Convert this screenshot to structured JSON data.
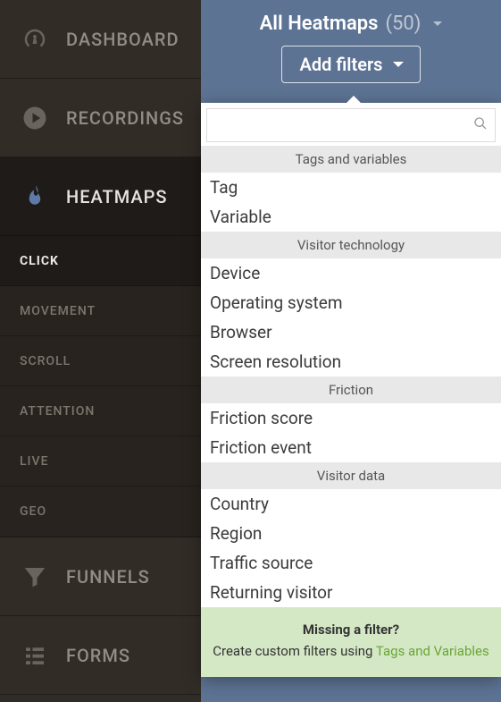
{
  "sidebar": {
    "items": [
      {
        "label": "DASHBOARD",
        "icon": "gauge",
        "active": false
      },
      {
        "label": "RECORDINGS",
        "icon": "play",
        "active": false
      },
      {
        "label": "HEATMAPS",
        "icon": "flame",
        "active": true
      },
      {
        "label": "FUNNELS",
        "icon": "funnel",
        "active": false
      },
      {
        "label": "FORMS",
        "icon": "list",
        "active": false
      }
    ],
    "heatmap_sub": [
      {
        "label": "CLICK",
        "active": true
      },
      {
        "label": "MOVEMENT",
        "active": false
      },
      {
        "label": "SCROLL",
        "active": false
      },
      {
        "label": "ATTENTION",
        "active": false
      },
      {
        "label": "LIVE",
        "active": false
      },
      {
        "label": "GEO",
        "active": false
      }
    ]
  },
  "panel": {
    "title": "All Heatmaps",
    "count_label": "(50)",
    "add_filters_label": "Add filters"
  },
  "filter_dropdown": {
    "search_placeholder": "",
    "sections": [
      {
        "header": "Tags and variables",
        "items": [
          "Tag",
          "Variable"
        ]
      },
      {
        "header": "Visitor technology",
        "items": [
          "Device",
          "Operating system",
          "Browser",
          "Screen resolution"
        ]
      },
      {
        "header": "Friction",
        "items": [
          "Friction score",
          "Friction event"
        ]
      },
      {
        "header": "Visitor data",
        "items": [
          "Country",
          "Region",
          "Traffic source",
          "Returning visitor"
        ]
      }
    ],
    "footer": {
      "title": "Missing a filter?",
      "text": "Create custom filters using ",
      "link_label": "Tags and Variables"
    }
  }
}
